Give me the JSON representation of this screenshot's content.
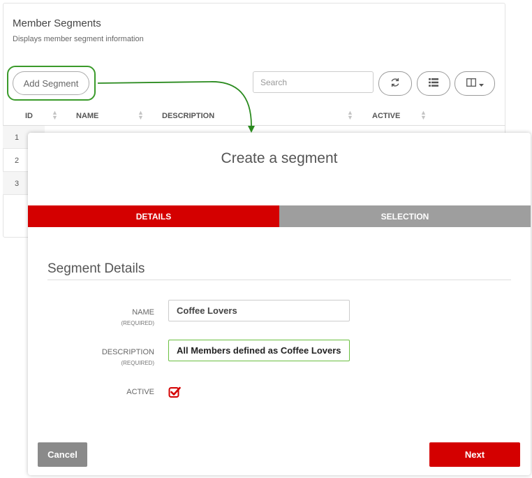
{
  "background": {
    "title": "Member Segments",
    "subtitle": "Displays member segment information",
    "add_segment_label": "Add Segment",
    "search_placeholder": "Search",
    "table": {
      "columns": [
        "ID",
        "NAME",
        "DESCRIPTION",
        "ACTIVE"
      ],
      "rows": [
        {
          "id": "1"
        },
        {
          "id": "2"
        },
        {
          "id": "3"
        }
      ]
    },
    "icons": {
      "refresh": "refresh-icon",
      "list": "list-icon",
      "columns": "columns-icon"
    }
  },
  "modal": {
    "title": "Create a segment",
    "steps": [
      {
        "label": "DETAILS",
        "active": true
      },
      {
        "label": "SELECTION",
        "active": false
      }
    ],
    "section_title": "Segment Details",
    "fields": {
      "name": {
        "label": "NAME",
        "required": "(REQUIRED)",
        "value": "Coffee Lovers"
      },
      "description": {
        "label": "DESCRIPTION",
        "required": "(REQUIRED)",
        "value": "All Members defined as Coffee Lovers"
      },
      "active": {
        "label": "ACTIVE",
        "checked": true
      }
    },
    "cancel_label": "Cancel",
    "next_label": "Next"
  },
  "colors": {
    "accent": "#d40000",
    "step_inactive": "#9e9e9e",
    "highlight": "#3a9a2a",
    "cancel": "#8a8a8a"
  }
}
